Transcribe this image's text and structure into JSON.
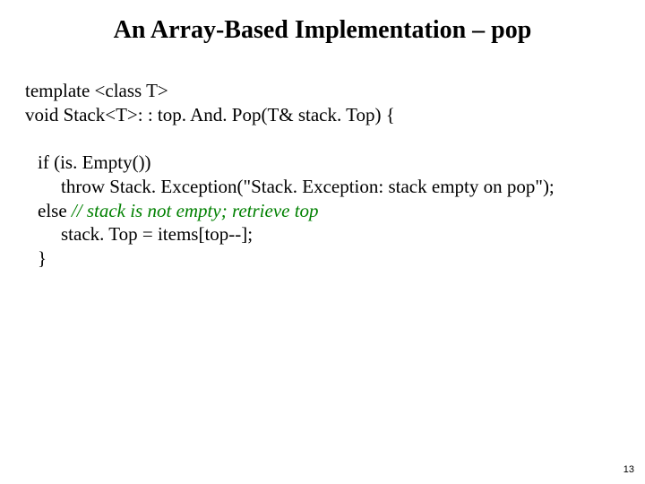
{
  "title": "An Array-Based Implementation – pop",
  "code": {
    "l1": "template <class T>",
    "l2a": "void Stack<T>: : top. And. Pop",
    "l2b": "(T& stack. Top) {",
    "l3": "if (is. Empty())",
    "l4": "throw Stack. Exception(\"Stack. Exception: stack empty on pop\");",
    "l5a": "else ",
    "l5b": "// stack is not empty; retrieve top",
    "l6": "stack. Top = items[top--];",
    "l7": "}"
  },
  "pagenum": "13"
}
